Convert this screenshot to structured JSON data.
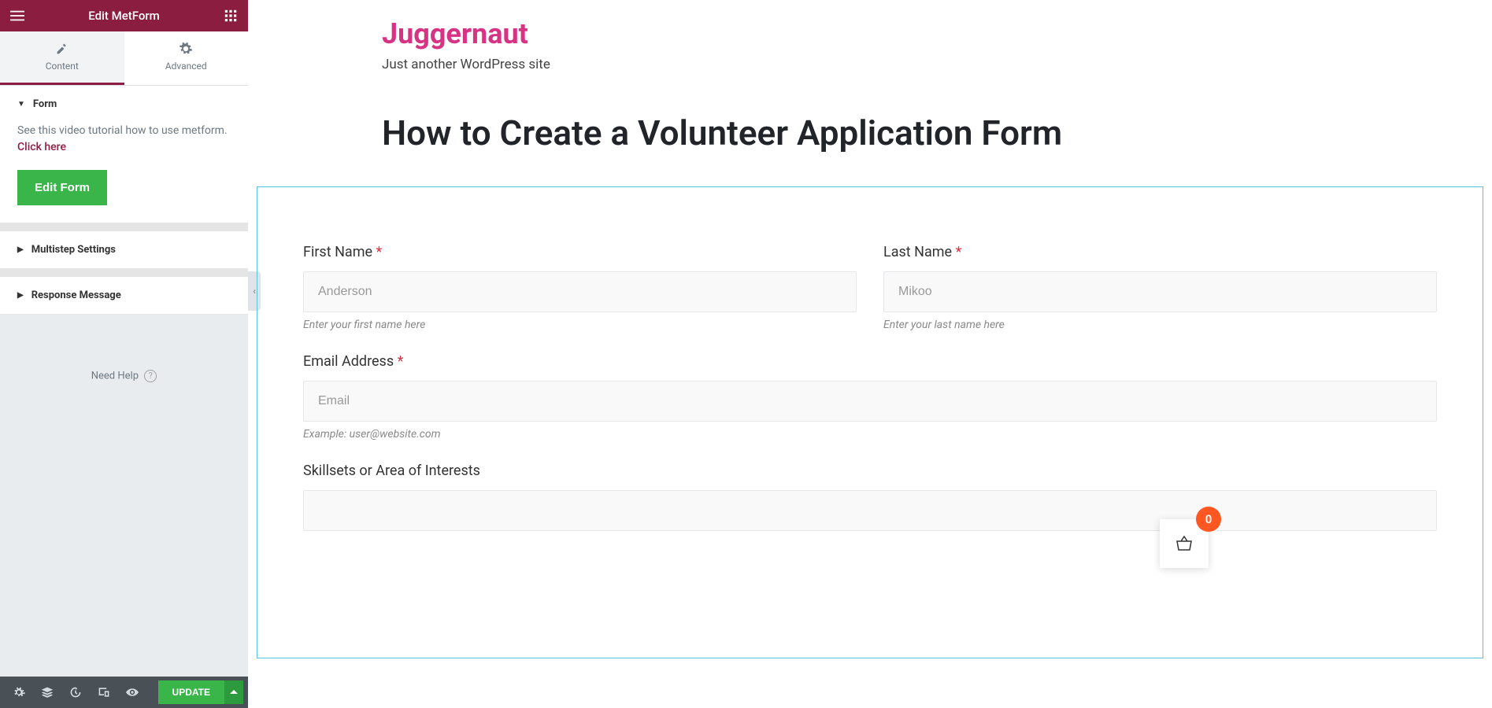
{
  "sidebar": {
    "title": "Edit MetForm",
    "tabs": {
      "content": "Content",
      "advanced": "Advanced"
    },
    "form_section": {
      "heading": "Form",
      "tutorial_text": "See this video tutorial how to use metform. ",
      "tutorial_link": "Click here",
      "edit_button": "Edit Form"
    },
    "multistep_heading": "Multistep Settings",
    "response_heading": "Response Message",
    "need_help": "Need Help",
    "footer": {
      "update": "UPDATE"
    }
  },
  "page": {
    "site_title": "Juggernaut",
    "site_tagline": "Just another WordPress site",
    "title": "How to Create a Volunteer Application Form"
  },
  "form": {
    "first_name": {
      "label": "First Name ",
      "placeholder": "Anderson",
      "helper": "Enter your first name here"
    },
    "last_name": {
      "label": "Last Name ",
      "placeholder": "Mikoo",
      "helper": "Enter your last name here"
    },
    "email": {
      "label": "Email Address ",
      "placeholder": "Email",
      "helper": "Example: user@website.com"
    },
    "skillsets": {
      "label": "Skillsets or Area of Interests"
    }
  },
  "cart": {
    "count": "0"
  }
}
